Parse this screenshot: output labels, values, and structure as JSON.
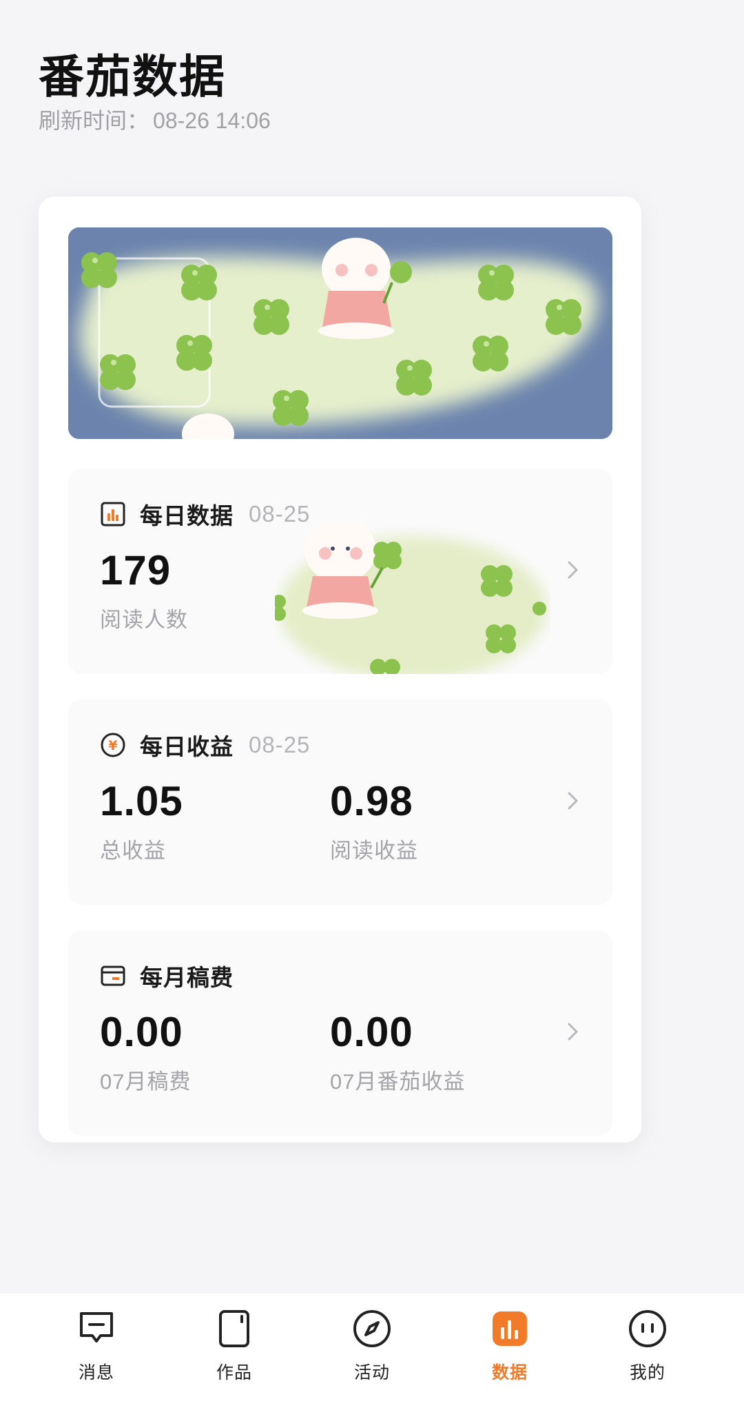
{
  "header": {
    "title": "番茄数据",
    "refresh_label": "刷新时间：",
    "refresh_time": "08-26 14:06"
  },
  "daily_data": {
    "title": "每日数据",
    "date": "08-25",
    "readers_value": "179",
    "readers_label": "阅读人数"
  },
  "daily_income": {
    "title": "每日收益",
    "date": "08-25",
    "total_value": "1.05",
    "total_label": "总收益",
    "read_value": "0.98",
    "read_label": "阅读收益"
  },
  "monthly_fee": {
    "title": "每月稿费",
    "fee_value": "0.00",
    "fee_label": "07月稿费",
    "tomato_value": "0.00",
    "tomato_label": "07月番茄收益"
  },
  "tabbar": {
    "items": [
      {
        "label": "消息",
        "icon": "message-icon"
      },
      {
        "label": "作品",
        "icon": "works-icon"
      },
      {
        "label": "活动",
        "icon": "compass-icon"
      },
      {
        "label": "数据",
        "icon": "chart-icon",
        "active": true
      },
      {
        "label": "我的",
        "icon": "face-icon"
      }
    ]
  },
  "colors": {
    "accent": "#f27b2a",
    "banner_bg": "#6c84ad",
    "banner_island": "#e6efcc",
    "clover": "#8cc24e"
  }
}
